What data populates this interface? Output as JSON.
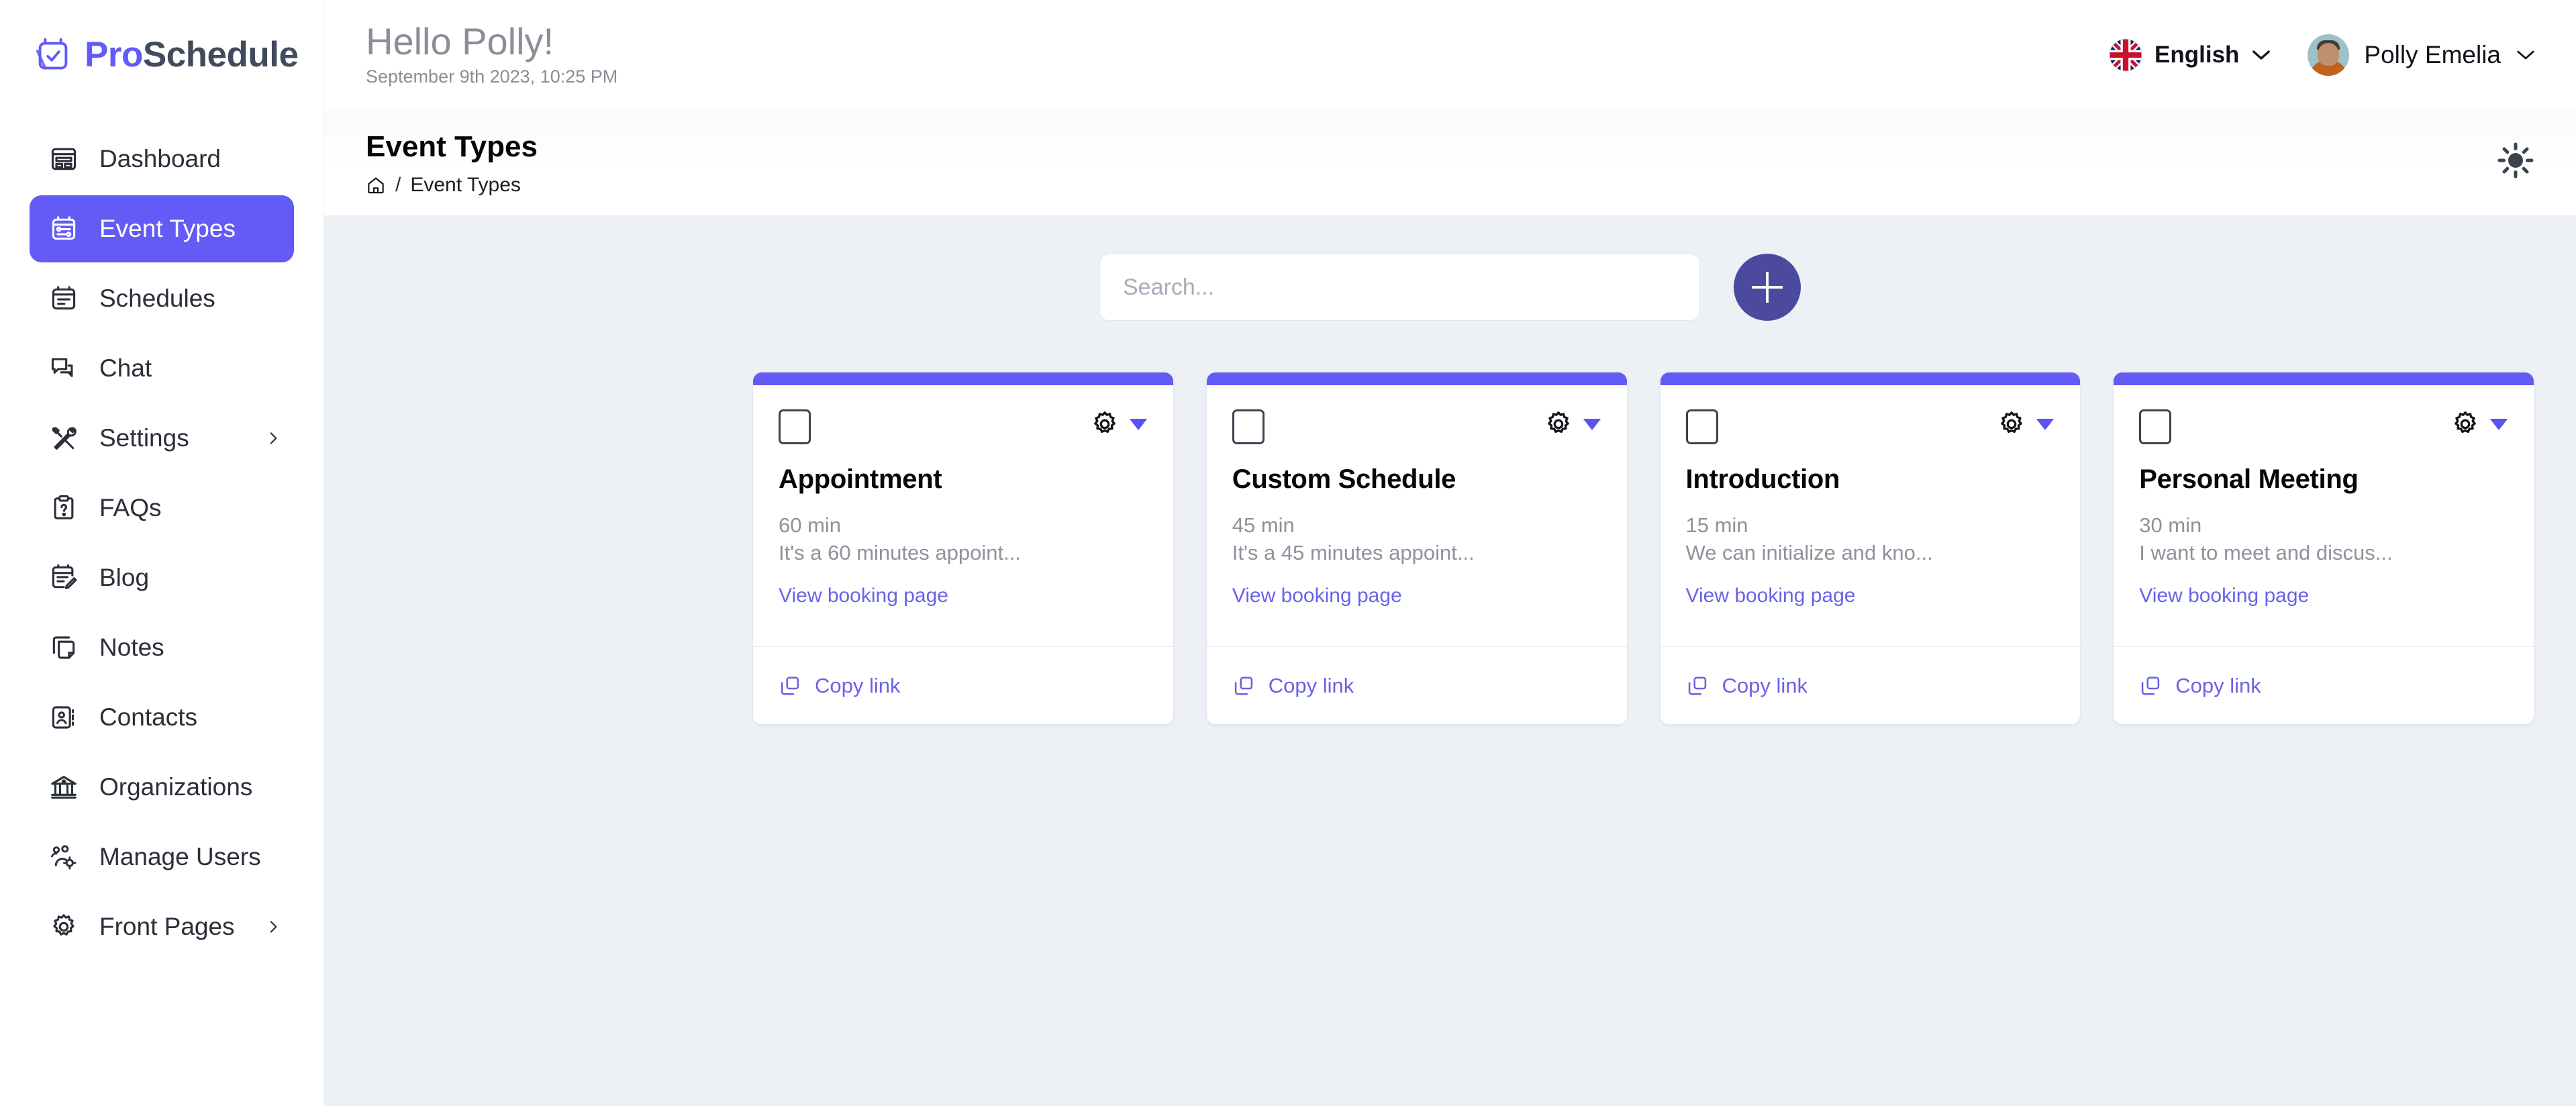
{
  "brand": {
    "name_part1": "Pro",
    "name_part2": "Schedule",
    "logo_icon": "calendar-check-icon",
    "accent_color": "#635bf5",
    "dark_color": "#414b5c"
  },
  "topbar": {
    "greeting": "Hello Polly!",
    "datetime": "September 9th 2023, 10:25 PM",
    "language": {
      "label": "English",
      "flag_icon": "uk-flag-icon",
      "chevron_icon": "chevron-down-icon"
    },
    "user": {
      "name": "Polly Emelia",
      "avatar_icon": "user-avatar-photo",
      "chevron_icon": "chevron-down-icon"
    }
  },
  "pagehead": {
    "title": "Event Types",
    "breadcrumb": {
      "home_icon": "home-icon",
      "separator": "/",
      "current": "Event Types"
    },
    "theme_toggle_icon": "sun-icon"
  },
  "sidebar": {
    "items": [
      {
        "label": "Dashboard",
        "icon": "dashboard-icon",
        "active": false,
        "expandable": false
      },
      {
        "label": "Event Types",
        "icon": "event-types-icon",
        "active": true,
        "expandable": false
      },
      {
        "label": "Schedules",
        "icon": "calendar-icon",
        "active": false,
        "expandable": false
      },
      {
        "label": "Chat",
        "icon": "chat-bubbles-icon",
        "active": false,
        "expandable": false
      },
      {
        "label": "Settings",
        "icon": "tools-icon",
        "active": false,
        "expandable": true
      },
      {
        "label": "FAQs",
        "icon": "clipboard-question-icon",
        "active": false,
        "expandable": false
      },
      {
        "label": "Blog",
        "icon": "note-pencil-icon",
        "active": false,
        "expandable": false
      },
      {
        "label": "Notes",
        "icon": "notes-icon",
        "active": false,
        "expandable": false
      },
      {
        "label": "Contacts",
        "icon": "contact-card-icon",
        "active": false,
        "expandable": false
      },
      {
        "label": "Organizations",
        "icon": "bank-icon",
        "active": false,
        "expandable": false
      },
      {
        "label": "Manage Users",
        "icon": "users-gear-icon",
        "active": false,
        "expandable": false
      },
      {
        "label": "Front Pages",
        "icon": "gear-icon",
        "active": false,
        "expandable": true
      }
    ]
  },
  "toolbar": {
    "search_placeholder": "Search...",
    "search_value": "",
    "add_button_icon": "plus-icon",
    "add_button_color": "#4c4a9e"
  },
  "cards": [
    {
      "title": "Appointment",
      "duration": "60 min",
      "description": "It's a 60 minutes appoint...",
      "view_link": "View booking page",
      "copy_link": "Copy link",
      "checkbox_checked": false,
      "settings_icon": "gear-icon",
      "caret_icon": "caret-down-icon",
      "copy_icon": "copy-icon",
      "accent": "#635bf5"
    },
    {
      "title": "Custom Schedule",
      "duration": "45 min",
      "description": "It's a 45 minutes appoint...",
      "view_link": "View booking page",
      "copy_link": "Copy link",
      "checkbox_checked": false,
      "settings_icon": "gear-icon",
      "caret_icon": "caret-down-icon",
      "copy_icon": "copy-icon",
      "accent": "#635bf5"
    },
    {
      "title": "Introduction",
      "duration": "15 min",
      "description": "We can initialize and kno...",
      "view_link": "View booking page",
      "copy_link": "Copy link",
      "checkbox_checked": false,
      "settings_icon": "gear-icon",
      "caret_icon": "caret-down-icon",
      "copy_icon": "copy-icon",
      "accent": "#635bf5"
    },
    {
      "title": "Personal Meeting",
      "duration": "30 min",
      "description": "I want to meet and discus...",
      "view_link": "View booking page",
      "copy_link": "Copy link",
      "checkbox_checked": false,
      "settings_icon": "gear-icon",
      "caret_icon": "caret-down-icon",
      "copy_icon": "copy-icon",
      "accent": "#635bf5"
    }
  ]
}
